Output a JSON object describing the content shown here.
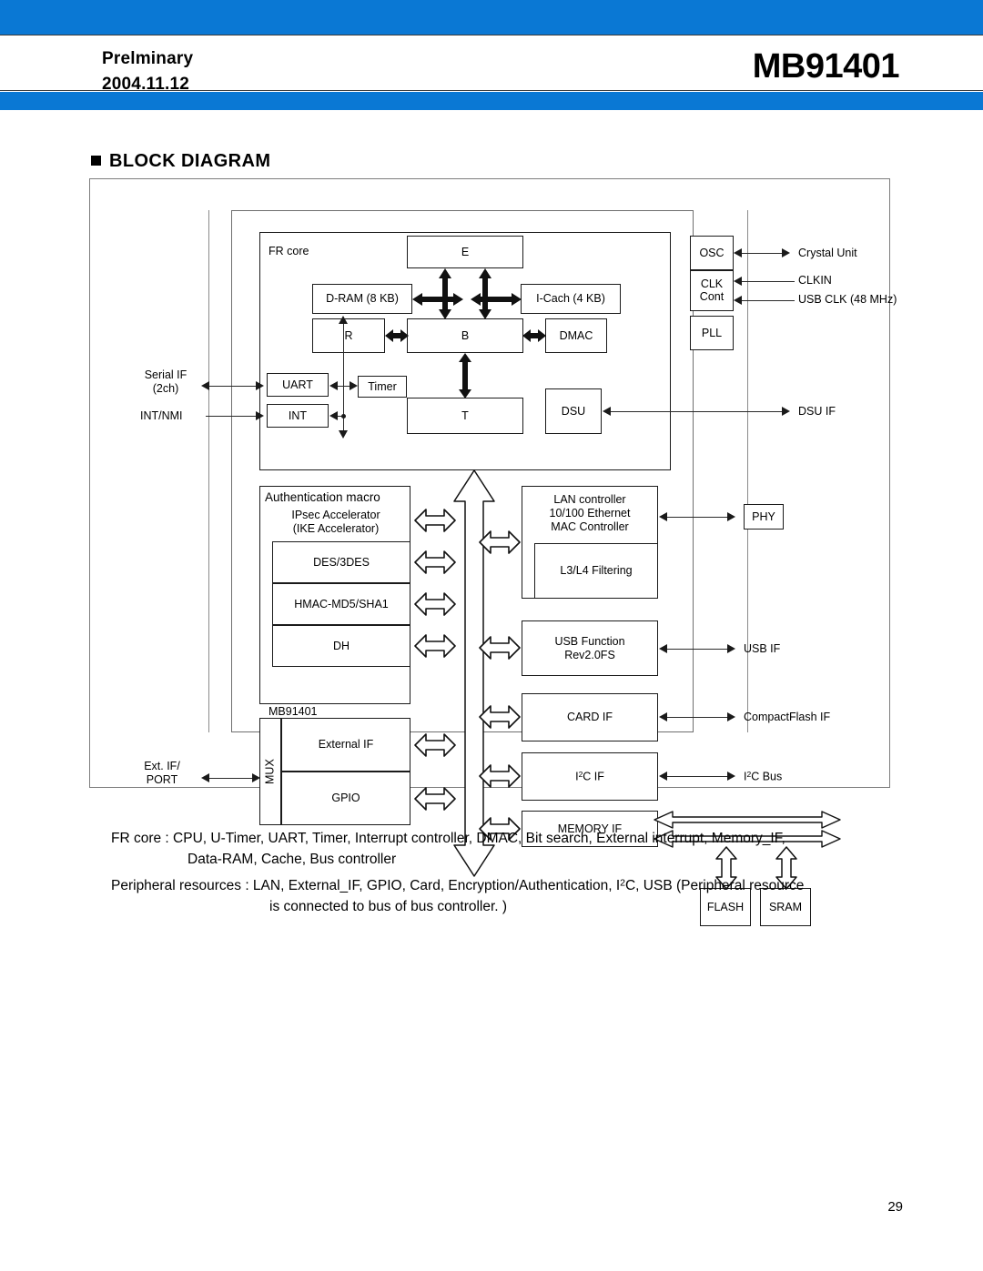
{
  "header": {
    "status": "Prelminary",
    "date": "2004.11.12",
    "part_number": "MB91401",
    "accent_color": "#0a78d4"
  },
  "section": {
    "title": "BLOCK DIAGRAM",
    "bullet": "square-bullet"
  },
  "diagram": {
    "chip_label": "MB91401",
    "core": {
      "label": "FR core",
      "blocks": [
        {
          "name": "e-block",
          "label": "E"
        },
        {
          "name": "d-ram",
          "label": "D-RAM (8 KB)"
        },
        {
          "name": "i-cache",
          "label": "I-Cach (4 KB)"
        },
        {
          "name": "r-block",
          "label": "R"
        },
        {
          "name": "b-block",
          "label": "B"
        },
        {
          "name": "dmac",
          "label": "DMAC"
        },
        {
          "name": "uart",
          "label": "UART"
        },
        {
          "name": "timer",
          "label": "Timer"
        },
        {
          "name": "int",
          "label": "INT"
        },
        {
          "name": "t-block",
          "label": "T"
        },
        {
          "name": "dsu",
          "label": "DSU"
        }
      ]
    },
    "clock_blocks": [
      {
        "name": "osc",
        "label": "OSC"
      },
      {
        "name": "clk-cont",
        "label_line1": "CLK",
        "label_line2": "Cont"
      },
      {
        "name": "pll",
        "label": "PLL"
      }
    ],
    "auth_macro": {
      "title": "Authentication macro",
      "subtitle_line1": "IPsec Accelerator",
      "subtitle_line2": "(IKE Accelerator)",
      "blocks": [
        {
          "name": "des-3des",
          "label": "DES/3DES"
        },
        {
          "name": "hmac-md5-sha1",
          "label": "HMAC-MD5/SHA1"
        },
        {
          "name": "dh",
          "label": "DH"
        }
      ]
    },
    "mux": {
      "label": "MUX",
      "blocks": [
        {
          "name": "external-if",
          "label": "External IF"
        },
        {
          "name": "gpio",
          "label": "GPIO"
        }
      ]
    },
    "peripherals": [
      {
        "name": "lan-controller",
        "line1": "LAN controller",
        "line2": "10/100 Ethernet",
        "line3": "MAC Controller"
      },
      {
        "name": "l3-l4-filtering",
        "label": "L3/L4 Filtering"
      },
      {
        "name": "usb-function",
        "line1": "USB Function",
        "line2": "Rev2.0FS"
      },
      {
        "name": "card-if",
        "label": "CARD IF"
      },
      {
        "name": "i2c-if",
        "label": "I2C IF"
      },
      {
        "name": "memory-if",
        "label": "MEMORY IF"
      }
    ],
    "external_left": [
      {
        "name": "serial-if",
        "line1": "Serial IF",
        "line2": "(2ch)"
      },
      {
        "name": "int-nmi",
        "label": "INT/NMI"
      },
      {
        "name": "ext-if-port",
        "line1": "Ext. IF/",
        "line2": "PORT"
      }
    ],
    "external_right": [
      {
        "name": "crystal-unit",
        "label": "Crystal Unit"
      },
      {
        "name": "clkin",
        "label": "CLKIN"
      },
      {
        "name": "usb-clk",
        "label": "USB CLK (48 MHz)"
      },
      {
        "name": "dsu-if",
        "label": "DSU IF"
      },
      {
        "name": "phy",
        "label": "PHY"
      },
      {
        "name": "usb-if",
        "label": "USB IF"
      },
      {
        "name": "compactflash-if",
        "label": "CompactFlash IF"
      },
      {
        "name": "i2c-bus",
        "label": "I2C Bus"
      },
      {
        "name": "flash",
        "label": "FLASH"
      },
      {
        "name": "sram",
        "label": "SRAM"
      }
    ]
  },
  "caption": {
    "fr_core_line1": "FR core :  CPU, U-Timer, UART, Timer, Interrupt controller, DMAC, Bit search, External interrupt, Memory_IF,",
    "fr_core_line2": "Data-RAM, Cache, Bus controller",
    "peripheral_line1_a": "Peripheral resources : LAN, External_IF, GPIO, Card, Encryption/Authentication, I",
    "peripheral_line1_b": "C, USB (Peripheral resource",
    "peripheral_line2": "is connected to bus of bus controller. )"
  },
  "footer": {
    "page_number": "29"
  }
}
